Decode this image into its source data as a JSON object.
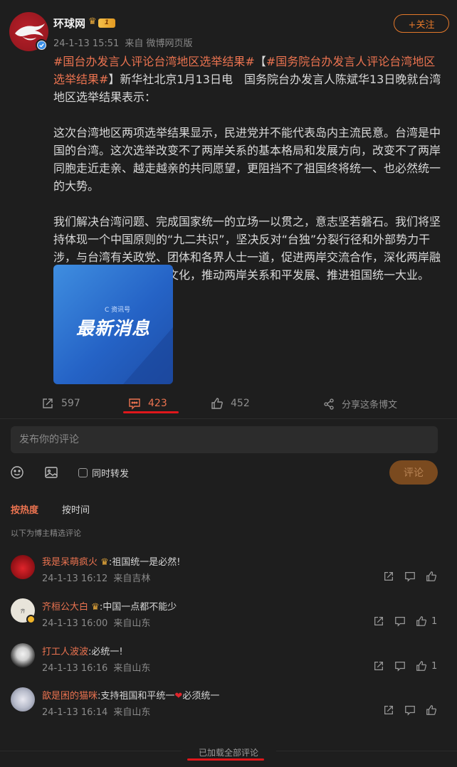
{
  "post": {
    "author": "环球网",
    "level_badge": "1",
    "time": "24-1-13 15:51",
    "source": "来自 微博网页版",
    "follow_label": "+关注",
    "hashtag1": "#国台办发言人评论台湾地区选举结果#",
    "bracket_open": "【",
    "hashtag2": "#国务院台办发言人评论台湾地区选举结果#",
    "intro": "】新华社北京1月13日电　国务院台办发言人陈斌华13日晚就台湾地区选举结果表示：",
    "para1": "这次台湾地区两项选举结果显示，民进党并不能代表岛内主流民意。台湾是中国的台湾。这次选举改变不了两岸关系的基本格局和发展方向，改变不了两岸同胞走近走亲、越走越亲的共同愿望，更阻挡不了祖国终将统一、也必然统一的大势。",
    "para2": "我们解决台湾问题、完成国家统一的立场一以贯之，意志坚若磐石。我们将坚持体现一个中国原则的“九二共识”，坚决反对“台独”分裂行径和外部势力干涉，与台湾有关政党、团体和各界人士一道，促进两岸交流合作，深化两岸融合发展，共同弘扬中华文化，推动两岸关系和平发展、推进祖国统一大业。（新华社）",
    "image": {
      "logo_text": "C 资讯号",
      "headline": "最新消息"
    }
  },
  "actions": {
    "reposts": "597",
    "comments": "423",
    "likes": "452",
    "share_label": "分享这条博文"
  },
  "composer": {
    "placeholder": "发布你的评论",
    "repost_label": "同时转发",
    "submit_label": "评论"
  },
  "sort": {
    "hot": "按热度",
    "time": "按时间",
    "curated_note": "以下为博主精选评论"
  },
  "comments": [
    {
      "name": "我是呆萌疯火",
      "text": ":祖国统一是必然!",
      "time": "24-1-13 16:12",
      "location": "来自吉林",
      "likes": ""
    },
    {
      "name": "齐桓公大白",
      "text": ":中国一点都不能少",
      "time": "24-1-13 16:00",
      "location": "来自山东",
      "likes": "1"
    },
    {
      "name": "打工人波波",
      "text": ":必统一!",
      "time": "24-1-13 16:16",
      "location": "来自山东",
      "likes": "1"
    },
    {
      "name": "歆是困的猫咪",
      "text_before": ":支持祖国和平统一",
      "text_after": "必须统一",
      "time": "24-1-13 16:14",
      "location": "来自山东",
      "likes": ""
    }
  ],
  "footer": {
    "loaded_all": "已加载全部评论"
  },
  "colors": {
    "background": "#1e1e1e",
    "accent_orange": "#eb7350",
    "annotation_red": "#e0171b"
  }
}
